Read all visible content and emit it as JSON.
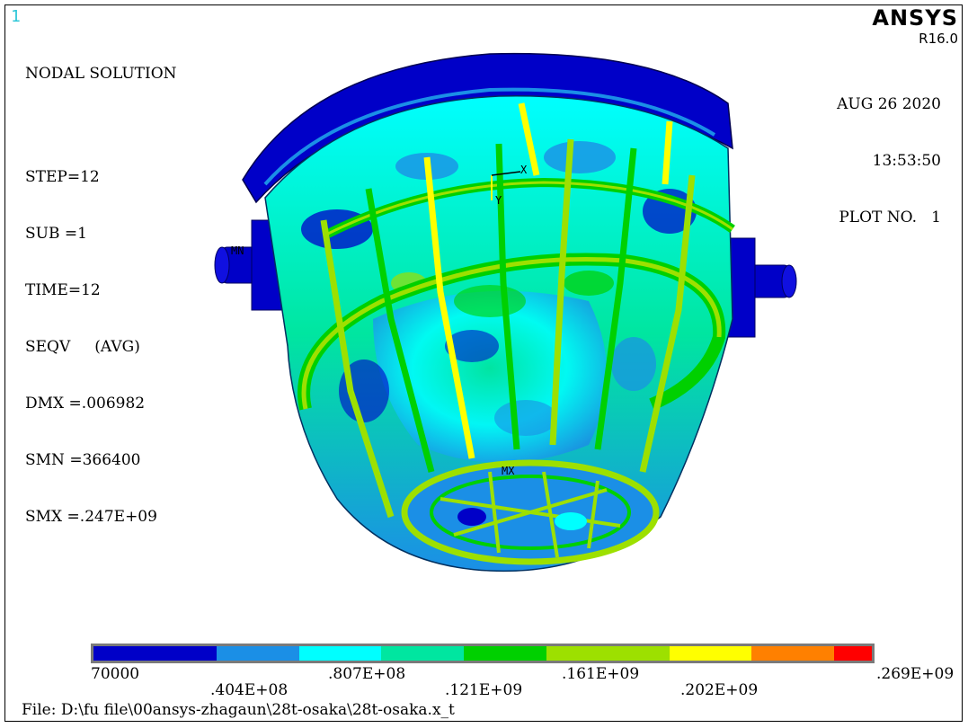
{
  "window_number": "1",
  "plot_info": {
    "lines": [
      "NODAL SOLUTION",
      "",
      "STEP=12",
      "SUB =1",
      "TIME=12",
      "SEQV     (AVG)",
      "DMX =.006982",
      "SMN =366400",
      "SMX =.247E+09"
    ]
  },
  "brand": {
    "logo": "ANSYS",
    "version": "R16.0"
  },
  "date_block": {
    "date": "AUG 26 2020",
    "time": "13:53:50",
    "plot_no": "PLOT NO.   1"
  },
  "model_labels": {
    "mn": "MN",
    "mx": "MX",
    "axis_x": "X",
    "axis_y": "Y"
  },
  "legend": {
    "colors": [
      "#0000c8",
      "#1b8fe6",
      "#00ffff",
      "#00e6a0",
      "#00d000",
      "#9de000",
      "#ffff00",
      "#ff8000",
      "#ff0000"
    ],
    "labels_top": [
      "70000",
      ".807E+08",
      ".161E+09",
      ".269E+09"
    ],
    "labels_bottom": [
      ".404E+08",
      ".121E+09",
      ".202E+09"
    ]
  },
  "file_path": "File: D:\\fu file\\00ansys-zhagaun\\28t-osaka\\28t-osaka.x_t"
}
